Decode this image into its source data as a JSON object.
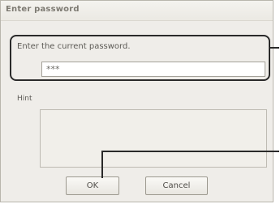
{
  "dialog": {
    "title": "Enter password",
    "prompt": "Enter the current password.",
    "password_value": "***",
    "hint_label": "Hint",
    "hint_value": "",
    "ok_label": "OK",
    "cancel_label": "Cancel"
  }
}
